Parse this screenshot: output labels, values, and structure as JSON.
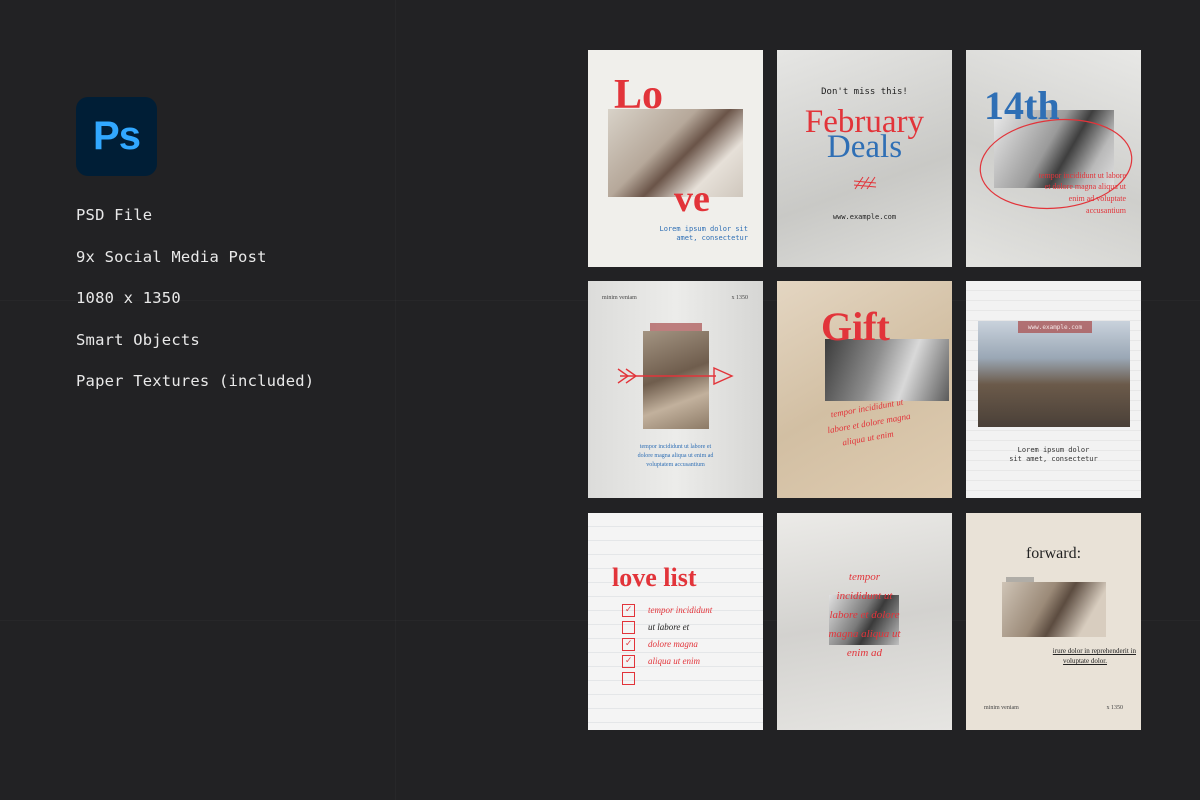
{
  "app": {
    "logo_text": "Ps"
  },
  "features": [
    "PSD File",
    "9x Social Media Post",
    "1080 x 1350",
    "Smart Objects",
    "Paper Textures (included)"
  ],
  "cards": {
    "c1": {
      "title_a": "Lo",
      "title_b": "ve",
      "body_1": "Lorem ipsum dolor sit",
      "body_2": "amet, consectetur"
    },
    "c2": {
      "kicker": "Don't miss this!",
      "title_a": "February",
      "title_b": "Deals",
      "url": "www.example.com"
    },
    "c3": {
      "title": "14th",
      "body_1": "tempor incididunt ut labore",
      "body_2": "et dolore magna aliqua ut",
      "body_3": "enim ad voluptate",
      "body_4": "accusantium"
    },
    "c4": {
      "top_left": "minim veniam",
      "top_right": "x 1350",
      "body_1": "tempor incididunt ut labore et",
      "body_2": "dolore magna aliqua ut enim ad",
      "body_3": "voluptatem accusantium"
    },
    "c5": {
      "title": "Gift",
      "body_1": "tempor incididunt ut",
      "body_2": "labore et dolore magna",
      "body_3": "aliqua ut enim"
    },
    "c6": {
      "url": "www.example.com",
      "body_1": "Lorem ipsum dolor",
      "body_2": "sit amet, consectetur"
    },
    "c7": {
      "title": "love list",
      "items": [
        "tempor incididunt",
        "ut labore et",
        "dolore magna",
        "aliqua ut enim"
      ]
    },
    "c8": {
      "body_1": "tempor",
      "body_2": "incididunt ut",
      "body_3": "labore et dolore",
      "body_4": "magna aliqua ut",
      "body_5": "enim ad"
    },
    "c9": {
      "title": "forward:",
      "body_1": "irure dolor in reprehenderit in",
      "body_2": "voluptate dolor.",
      "footer_left": "minim veniam",
      "footer_right": "x 1350"
    }
  },
  "colors": {
    "background": "#222224",
    "accent_red": "#e2343a",
    "accent_blue": "#2f6fb5",
    "ps_blue": "#31a8ff",
    "ps_navy": "#001e36"
  }
}
